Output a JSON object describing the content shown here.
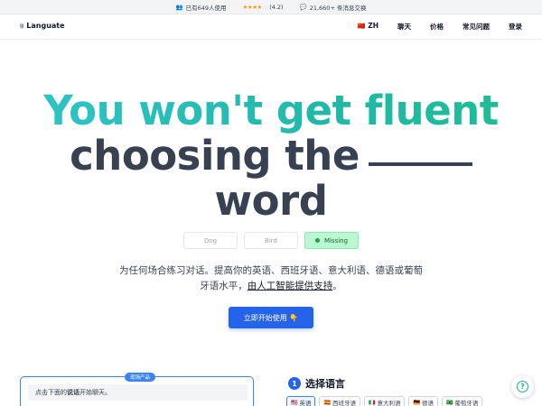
{
  "topbar": {
    "users_icon": "users-icon",
    "users_text": "已有649人使用",
    "stars": "★★★★",
    "star_dim": "☆",
    "rating": "(4.2)",
    "messages_icon": "chat-icon",
    "messages_text": "21,660+ 条消息交换"
  },
  "nav": {
    "logo_mark": "",
    "logo_text": "Languate",
    "language_flag": "🇨🇳",
    "language_code": "ZH",
    "items": [
      "聊天",
      "价格",
      "常见问题",
      "登录"
    ]
  },
  "hero": {
    "line1": "You won't get fluent",
    "line2": "choosing the",
    "line3": "word"
  },
  "choices": [
    "Dog",
    "Bird",
    "Missing"
  ],
  "subtitle": {
    "text_before": "为任何场合练习对话。提高你的英语、西班牙语、意大利语、德语或葡萄牙语水平，",
    "link": "由人工智能提供支持",
    "text_after": "。"
  },
  "cta": {
    "label": "立即开始使用 👇"
  },
  "demo": {
    "badge": "现场产品",
    "hint_before": "点击下面的",
    "hint_bold": "说话",
    "hint_after": "开始聊天。"
  },
  "step": {
    "number": "1",
    "title": "选择语言"
  },
  "languages": [
    {
      "flag": "🇺🇸",
      "name": "英语"
    },
    {
      "flag": "🇪🇸",
      "name": "西班牙语"
    },
    {
      "flag": "🇮🇹",
      "name": "意大利语"
    },
    {
      "flag": "🇩🇪",
      "name": "德语"
    },
    {
      "flag": "🇧🇷",
      "name": "葡萄牙语"
    }
  ],
  "help": {
    "glyph": "?"
  },
  "colors": {
    "accent": "#2563eb",
    "hero_gradient_start": "#2ec5c9",
    "hero_gradient_end": "#1bbf8f",
    "selected_choice": "#bbf7d0"
  }
}
